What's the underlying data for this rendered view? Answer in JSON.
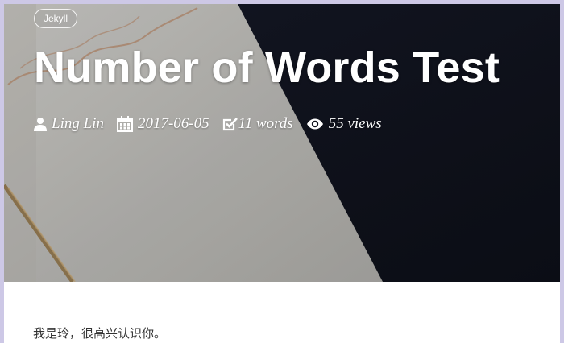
{
  "post": {
    "tag": "Jekyll",
    "title": "Number of Words Test",
    "meta": {
      "author": "Ling Lin",
      "date": "2017-06-05",
      "word_count": "11 words",
      "views": "55 views"
    }
  },
  "content": {
    "paragraph": "我是玲，很高兴认识你。"
  },
  "icons": {
    "author": "user-icon",
    "date": "calendar-icon",
    "words": "check-square-icon",
    "views": "eye-icon"
  },
  "colors": {
    "hero_dark": "#11131d",
    "paper": "#b9b8b4",
    "text_on_hero": "#ffffff",
    "page_border": "#cdc8e6"
  }
}
